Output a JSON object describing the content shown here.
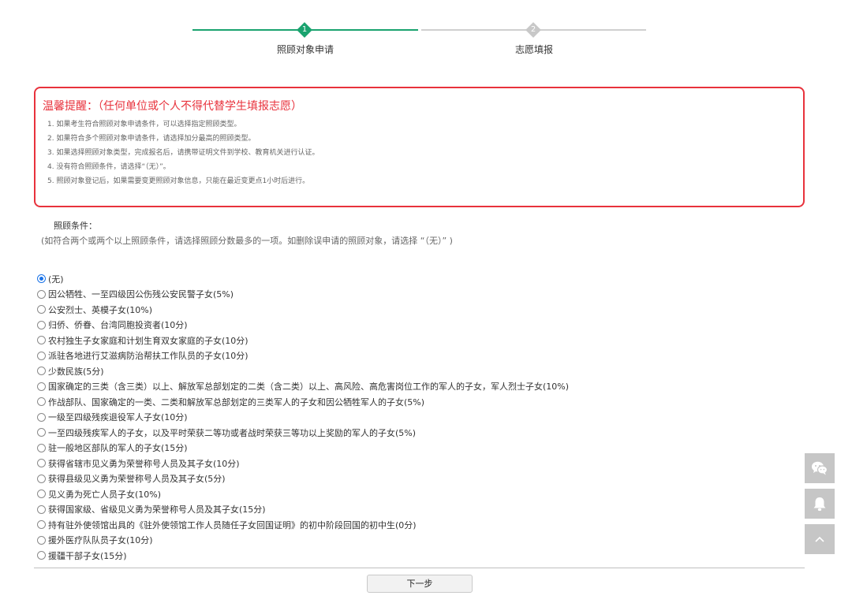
{
  "stepper": {
    "steps": [
      {
        "number": "1",
        "label": "照顾对象申请",
        "active": true
      },
      {
        "number": "2",
        "label": "志愿填报",
        "active": false
      }
    ],
    "active_color": "#1aa36f",
    "inactive_color": "#c8c8c8"
  },
  "notice": {
    "title": "温馨提醒：（任何单位或个人不得代替学生填报志愿）",
    "items": [
      "1. 如果考生符合照顾对象申请条件，可以选择指定照顾类型。",
      "2. 如果符合多个照顾对象申请条件，请选择加分最高的照顾类型。",
      "3. 如果选择照顾对象类型，完成报名后，请携带证明文件到学校、教育机关进行认证。",
      "4. 没有符合照顾条件，请选择“（无）”。",
      "5. 照顾对象登记后，如果需要变更照顾对象信息，只能在最近变更点1小时后进行。"
    ],
    "border_color": "#e8323c"
  },
  "conditions": {
    "title": "照顾条件：",
    "hint": "(如符合两个或两个以上照顾条件，请选择照顾分数最多的一项。如删除误申请的照顾对象，请选择 “（无）” )",
    "selected_index": 0,
    "options": [
      "(无)",
      "因公牺牲、一至四级因公伤残公安民警子女(5%)",
      "公安烈士、英模子女(10%)",
      "归侨、侨眷、台湾同胞投资者(10分)",
      "农村独生子女家庭和计划生育双女家庭的子女(10分)",
      "派驻各地进行艾滋病防治帮扶工作队员的子女(10分)",
      "少数民族(5分)",
      "国家确定的三类（含三类）以上、解放军总部划定的二类（含二类）以上、高风险、高危害岗位工作的军人的子女，军人烈士子女(10%)",
      "作战部队、国家确定的一类、二类和解放军总部划定的三类军人的子女和因公牺牲军人的子女(5%)",
      "一级至四级残疾退役军人子女(10分)",
      "一至四级残疾军人的子女，以及平时荣获二等功或者战时荣获三等功以上奖励的军人的子女(5%)",
      "驻一般地区部队的军人的子女(15分)",
      "获得省辖市见义勇为荣誉称号人员及其子女(10分)",
      "获得县级见义勇为荣誉称号人员及其子女(5分)",
      "见义勇为死亡人员子女(10%)",
      "获得国家级、省级见义勇为荣誉称号人员及其子女(15分)",
      "持有驻外使领馆出具的《驻外使领馆工作人员随任子女回国证明》的初中阶段回国的初中生(0分)",
      "援外医疗队队员子女(10分)",
      "援疆干部子女(15分)"
    ]
  },
  "footer": {
    "next_label": "下一步"
  },
  "floating": {
    "buttons": [
      "wechat-icon",
      "bell-icon",
      "arrow-up-icon"
    ]
  }
}
